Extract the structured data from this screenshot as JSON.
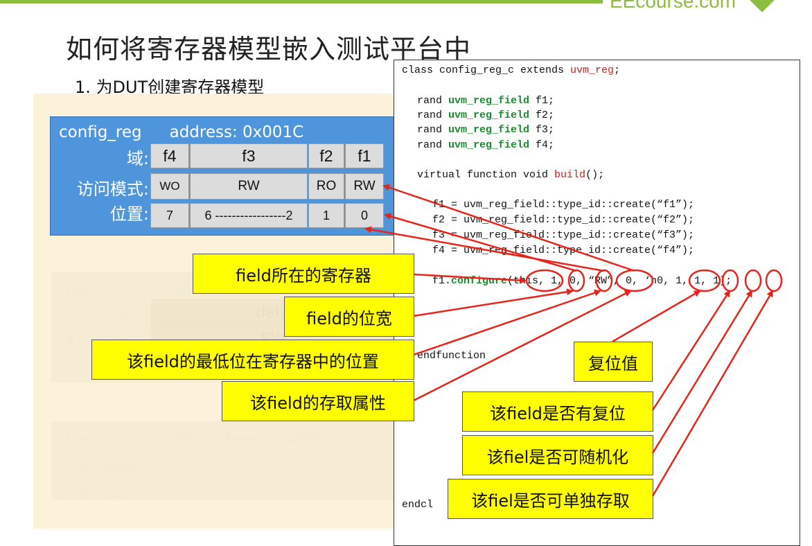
{
  "brand": "EEcourse.com",
  "title": "如何将寄存器模型嵌入测试平台中",
  "subtitle": "1.  为DUT创建寄存器模型",
  "config_reg": {
    "name": "config_reg",
    "address": "address: 0x001C",
    "labels": {
      "fields": "域:",
      "access": "访问模式:",
      "position": "位置:"
    },
    "fields": [
      "f4",
      "f3",
      "f2",
      "f1"
    ],
    "access": [
      "WO",
      "RW",
      "RO",
      "RW"
    ],
    "positions": [
      "7",
      "6 -----------------2",
      "1",
      "0"
    ]
  },
  "faded": {
    "mode_reg": "mode_reg",
    "mode_addr": "ad",
    "mode_field_label": "域:",
    "mode_access_label": "访问模式:",
    "mode_field": "data",
    "mode_access": "RW",
    "mem_name": "data_mem",
    "mem_addr": "first address: 0x1000",
    "mem_width": "位宽:  16bit",
    "mem_size": "大小:  512"
  },
  "code": {
    "line1_a": "class config_reg_c extends ",
    "line1_b": "uvm_reg",
    "line1_c": ";",
    "rand": "rand ",
    "field_type": "uvm_reg_field",
    "f1": " f1;",
    "f2": " f2;",
    "f3": " f3;",
    "f4": " f4;",
    "build_a": "virtual function void ",
    "build_b": "build",
    "build_c": "();",
    "c1": "f1 = uvm_reg_field::type_id::create(“f1”);",
    "c2": "f2 = uvm_reg_field::type_id::create(“f2”);",
    "c3": "f3 = uvm_reg_field::type_id::create(“f3”);",
    "c4": "f4 = uvm_reg_field::type_id::create(“f4”);",
    "cfg_a": "f1.",
    "cfg_b": "configure",
    "cfg_c": "(this, 1, 0, “RW”, 0, ‘h0, 1, 1, 1);",
    "endfunction": "endfunction",
    "endclass": "endcl"
  },
  "callouts": {
    "parent": "field所在的寄存器",
    "width": "field的位宽",
    "lsb": "该field的最低位在寄存器中的位置",
    "access": "该field的存取属性",
    "reset": "复位值",
    "has_reset": "该field是否有复位",
    "rand": "该fiel是否可随机化",
    "individual": "该fiel是否可单独存取"
  },
  "colors": {
    "accent_green": "#8cbd3f",
    "reg_blue": "#4f95dc",
    "callout_yellow": "#ffff00",
    "arrow_red": "#e8231a"
  }
}
